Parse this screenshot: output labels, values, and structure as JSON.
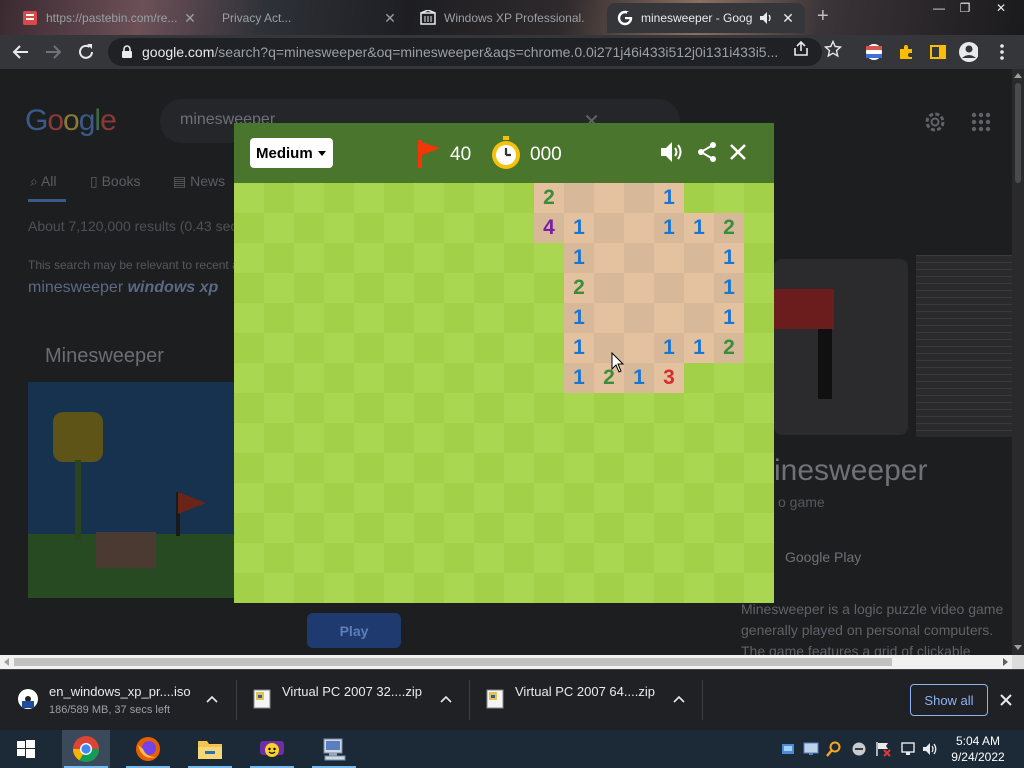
{
  "browser": {
    "tabs": [
      {
        "title": "https://pastebin.com/re...",
        "favicon": "pastebin-favicon"
      },
      {
        "title": "Privacy Act...",
        "favicon": "document-favicon"
      },
      {
        "title": "Windows XP Professional...",
        "favicon": "archive-favicon"
      },
      {
        "title": "minesweeper - Goog",
        "favicon": "google-favicon",
        "active": true
      }
    ],
    "url_host": "google.com",
    "url_rest": "/search?q=minesweeper&oq=minesweeper&aqs=chrome.0.0i271j46i433i512j0i131i433i5..."
  },
  "page": {
    "logo": [
      "G",
      "o",
      "o",
      "g",
      "l",
      "e"
    ],
    "query": "minesweeper",
    "tabs": [
      "All",
      "Books",
      "News"
    ],
    "stats": "About 7,120,000 results (0.43 sec",
    "relevant": "This search may be relevant to recent a",
    "suggest_plain": "minesweeper ",
    "suggest_bold": "windows xp",
    "section_heading": "Minesweeper",
    "play_label": "Play",
    "kp_title": "inesweeper",
    "kp_sub": "o game",
    "kp_store": "Google Play",
    "kp_desc": "Minesweeper is a logic puzzle video game generally played on personal computers. The game features a grid of clickable squares, with hid"
  },
  "game": {
    "difficulty": "Medium",
    "flags": "40",
    "time": "000",
    "revealed_color_light": "#e5c29f",
    "revealed_color_dark": "#d7b899",
    "grass_light": "#aad751",
    "grass_dark": "#a2d149",
    "numbers": [
      {
        "row": 0,
        "col": 10,
        "n": "2"
      },
      {
        "row": 0,
        "col": 14,
        "n": "1"
      },
      {
        "row": 1,
        "col": 10,
        "n": "4"
      },
      {
        "row": 1,
        "col": 11,
        "n": "1"
      },
      {
        "row": 1,
        "col": 14,
        "n": "1"
      },
      {
        "row": 1,
        "col": 15,
        "n": "1"
      },
      {
        "row": 1,
        "col": 16,
        "n": "2"
      },
      {
        "row": 2,
        "col": 11,
        "n": "1"
      },
      {
        "row": 2,
        "col": 16,
        "n": "1"
      },
      {
        "row": 3,
        "col": 11,
        "n": "2"
      },
      {
        "row": 3,
        "col": 16,
        "n": "1"
      },
      {
        "row": 4,
        "col": 11,
        "n": "1"
      },
      {
        "row": 4,
        "col": 16,
        "n": "1"
      },
      {
        "row": 5,
        "col": 11,
        "n": "1"
      },
      {
        "row": 5,
        "col": 14,
        "n": "1"
      },
      {
        "row": 5,
        "col": 15,
        "n": "1"
      },
      {
        "row": 5,
        "col": 16,
        "n": "2"
      },
      {
        "row": 6,
        "col": 11,
        "n": "1"
      },
      {
        "row": 6,
        "col": 12,
        "n": "2"
      },
      {
        "row": 6,
        "col": 13,
        "n": "1"
      },
      {
        "row": 6,
        "col": 14,
        "n": "3"
      }
    ],
    "revealed_empty": [
      [
        0,
        11
      ],
      [
        0,
        12
      ],
      [
        0,
        13
      ],
      [
        1,
        12
      ],
      [
        1,
        13
      ],
      [
        2,
        12
      ],
      [
        2,
        13
      ],
      [
        2,
        14
      ],
      [
        2,
        15
      ],
      [
        3,
        12
      ],
      [
        3,
        13
      ],
      [
        3,
        14
      ],
      [
        3,
        15
      ],
      [
        4,
        12
      ],
      [
        4,
        13
      ],
      [
        4,
        14
      ],
      [
        4,
        15
      ],
      [
        5,
        12
      ],
      [
        5,
        13
      ]
    ]
  },
  "downloads": [
    {
      "name": "en_windows_xp_pr....iso",
      "status": "186/589 MB, 37 secs left",
      "icon": "iso-file-icon"
    },
    {
      "name": "Virtual PC 2007 32....zip",
      "status": "",
      "icon": "zip-file-icon"
    },
    {
      "name": "Virtual PC 2007 64....zip",
      "status": "",
      "icon": "zip-file-icon"
    }
  ],
  "show_all": "Show all",
  "taskbar": {
    "apps": [
      "windows-start-icon",
      "chrome-icon",
      "firefox-icon",
      "file-explorer-icon",
      "yahoo-messenger-icon",
      "virtual-pc-icon"
    ],
    "time": "5:04 AM",
    "date": "9/24/2022"
  }
}
